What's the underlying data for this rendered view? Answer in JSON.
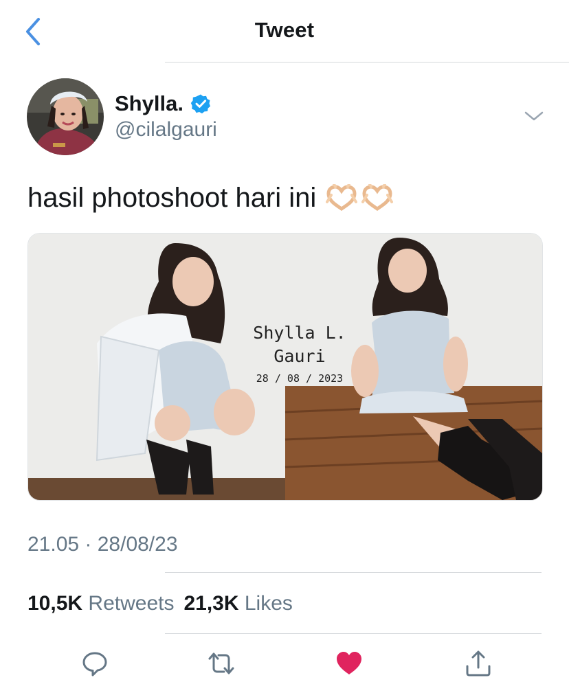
{
  "nav": {
    "title": "Tweet"
  },
  "author": {
    "display_name": "Shylla.",
    "handle": "@cilalgauri",
    "verified": true
  },
  "tweet": {
    "text": "hasil photoshoot hari ini",
    "emojis": [
      "heart-hands",
      "heart-hands"
    ],
    "media_watermark": {
      "name_line1": "Shylla L.",
      "name_line2": "Gauri",
      "date": "28 / 08 / 2023"
    },
    "timestamp": "21.05 · 28/08/23"
  },
  "stats": {
    "retweets_count": "10,5K",
    "retweets_label": "Retweets",
    "likes_count": "21,3K",
    "likes_label": "Likes"
  },
  "actions": [
    "reply-icon",
    "retweet-icon",
    "like-icon",
    "share-icon"
  ],
  "colors": {
    "accent": "#1da1f2",
    "back_blue": "#4a90e2",
    "like": "#e0245e",
    "secondary_text": "#657786"
  }
}
